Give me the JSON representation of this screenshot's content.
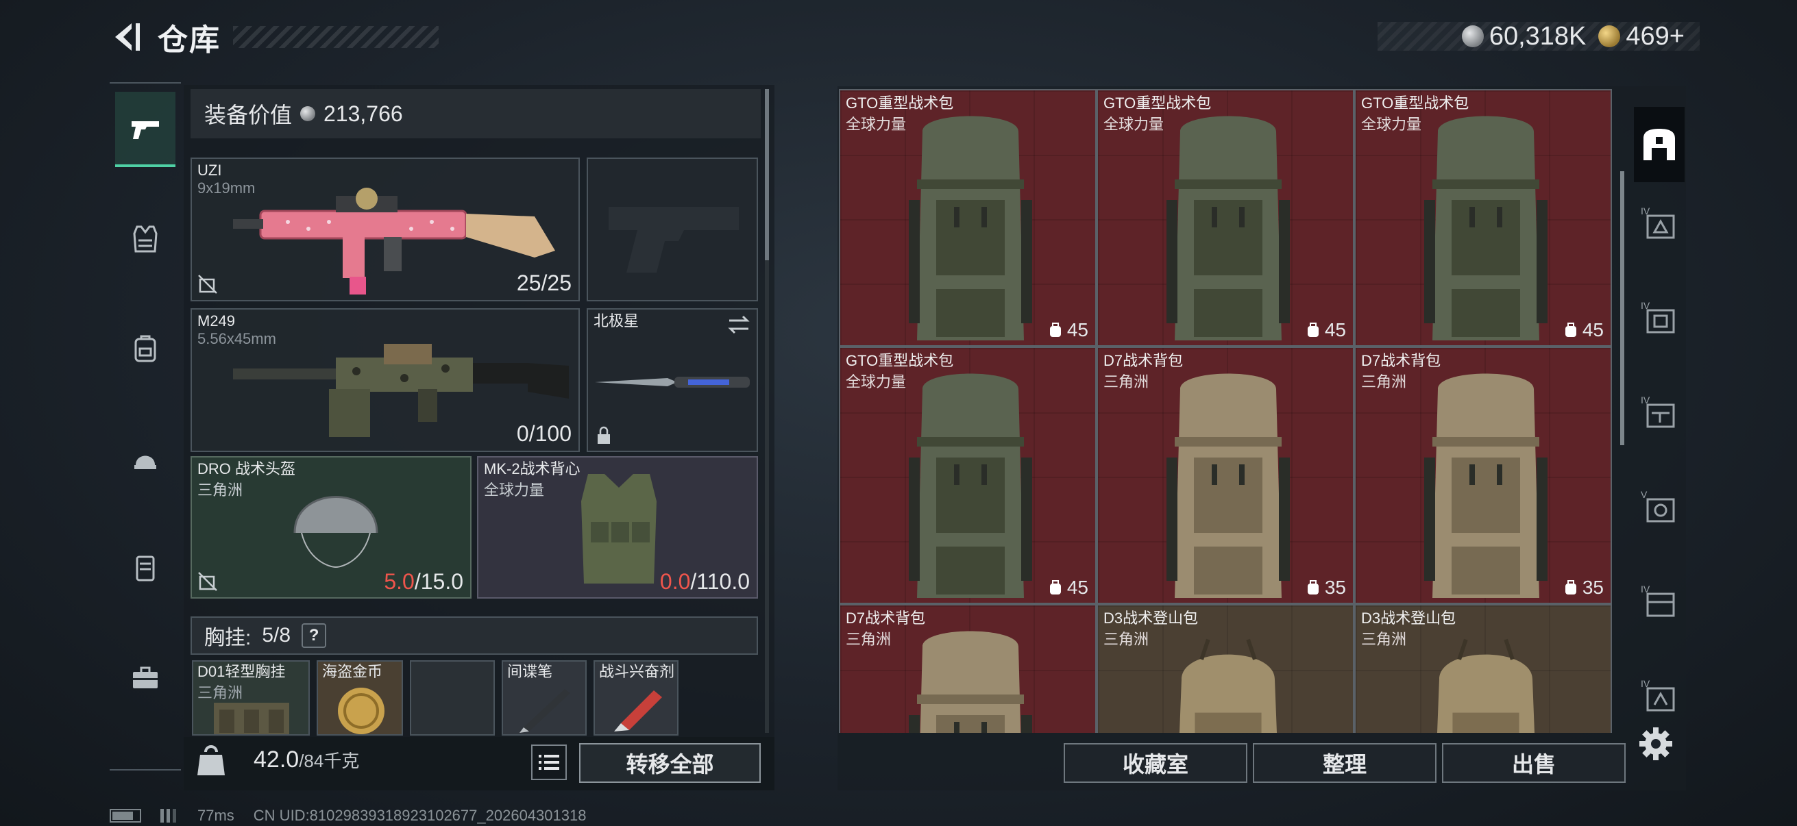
{
  "header": {
    "title": "仓库",
    "currency": [
      {
        "icon": "silver-coin-icon",
        "value": "60,318K"
      },
      {
        "icon": "gold-coin-icon",
        "value": "469+"
      }
    ]
  },
  "left_rail": {
    "tabs": [
      {
        "icon": "pistol-icon",
        "active": true
      },
      {
        "icon": "vest-icon",
        "active": false
      },
      {
        "icon": "backpack-icon",
        "active": false
      },
      {
        "icon": "helmet-bag-icon",
        "active": false
      },
      {
        "icon": "case-icon",
        "active": false
      },
      {
        "icon": "toolbox-icon",
        "active": false
      }
    ]
  },
  "equipment": {
    "value_label": "装备价值",
    "value": "213,766",
    "primary": {
      "name": "UZI",
      "caliber": "9x19mm",
      "ammo": "25/25"
    },
    "secondary": {
      "name": "M249",
      "caliber": "5.56x45mm",
      "ammo": "0/100"
    },
    "melee": {
      "name": "北极星"
    },
    "helmet": {
      "name": "DRO 战术头盔",
      "origin": "三角洲",
      "dur_current": "5.0",
      "dur_max": "/15.0"
    },
    "armor": {
      "name": "MK-2战术背心",
      "origin": "全球力量",
      "dur_current": "0.0",
      "dur_max": "/110.0"
    },
    "chest": {
      "label": "胸挂:",
      "value": "5/8",
      "help": "?"
    },
    "chest_items": [
      {
        "name": "D01轻型胸挂",
        "sub": "三角洲"
      },
      {
        "name": "海盗金币",
        "sub": ""
      },
      {
        "name": "",
        "sub": ""
      },
      {
        "name": "间谍笔",
        "sub": ""
      },
      {
        "name": "战斗兴奋剂",
        "sub": ""
      }
    ],
    "weight": "42.0",
    "weight_cap": "/84千克",
    "transfer_all": "转移全部"
  },
  "storage": {
    "items": [
      {
        "name": "GTO重型战术包",
        "origin": "全球力量",
        "capacity": "45",
        "color": "red"
      },
      {
        "name": "GTO重型战术包",
        "origin": "全球力量",
        "capacity": "45",
        "color": "red"
      },
      {
        "name": "GTO重型战术包",
        "origin": "全球力量",
        "capacity": "45",
        "color": "red"
      },
      {
        "name": "GTO重型战术包",
        "origin": "全球力量",
        "capacity": "45",
        "color": "red"
      },
      {
        "name": "D7战术背包",
        "origin": "三角洲",
        "capacity": "35",
        "color": "red"
      },
      {
        "name": "D7战术背包",
        "origin": "三角洲",
        "capacity": "35",
        "color": "red"
      },
      {
        "name": "D7战术背包",
        "origin": "三角洲",
        "capacity": "",
        "color": "red"
      },
      {
        "name": "D3战术登山包",
        "origin": "三角洲",
        "capacity": "",
        "color": "tan"
      },
      {
        "name": "D3战术登山包",
        "origin": "三角洲",
        "capacity": "",
        "color": "tan"
      }
    ],
    "buttons": {
      "collection": "收藏室",
      "sort": "整理",
      "sell": "出售"
    }
  },
  "right_rail": {
    "tabs": [
      "home-icon",
      "tier-iv-helmet-icon",
      "tier-iv-armor-icon",
      "tier-iv-gun-icon",
      "tier-v-gear-icon",
      "tier-iv-case-icon",
      "tier-iv-bag-icon"
    ]
  },
  "status_bar": {
    "ping": "77ms",
    "uid": "CN UID:81029839318923102677_202604301318"
  },
  "colors": {
    "accent": "#4fd1a5",
    "red_rarity": "#5e2328",
    "tan_rarity": "#4b4033",
    "warning": "#f0554c"
  }
}
